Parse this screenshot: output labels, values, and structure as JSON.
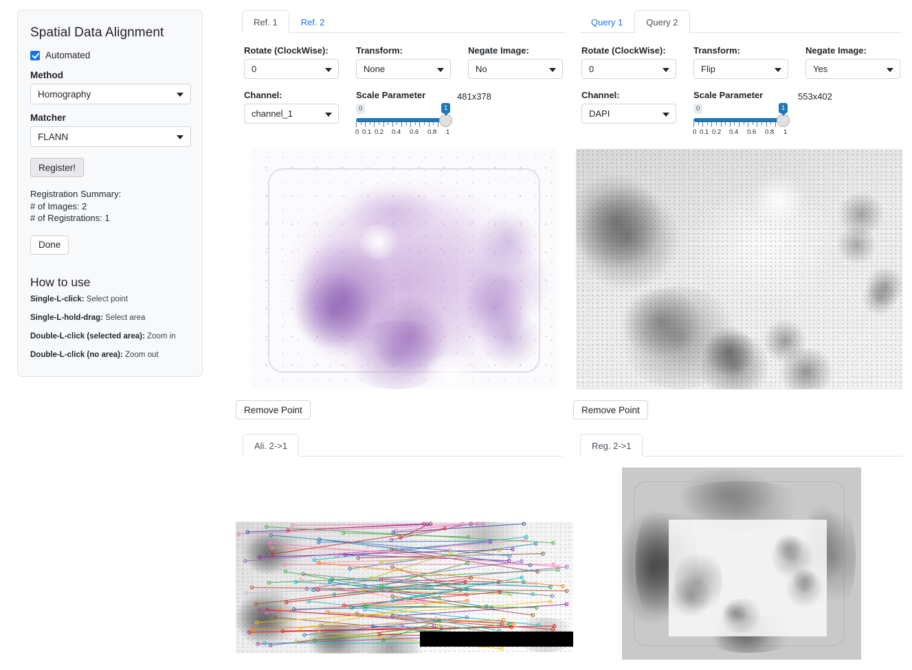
{
  "sidebar": {
    "title": "Spatial Data Alignment",
    "automated_label": "Automated",
    "automated_checked": true,
    "method_label": "Method",
    "method_value": "Homography",
    "matcher_label": "Matcher",
    "matcher_value": "FLANN",
    "register_button": "Register!",
    "summary": {
      "heading": "Registration Summary:",
      "images_line": "# of Images: 2",
      "registrations_line": "# of Registrations: 1"
    },
    "done_button": "Done",
    "howto": {
      "title": "How to use",
      "items": [
        {
          "key": "Single-L-click:",
          "value": " Select point"
        },
        {
          "key": "Single-L-hold-drag:",
          "value": " Select area"
        },
        {
          "key": "Double-L-click (selected area):",
          "value": " Zoom in"
        },
        {
          "key": "Double-L-click (no area):",
          "value": " Zoom out"
        }
      ]
    }
  },
  "reference_panel": {
    "tabs": [
      {
        "label": "Ref. 1",
        "active": true
      },
      {
        "label": "Ref. 2",
        "active": false
      }
    ],
    "controls": {
      "rotate_label": "Rotate (ClockWise):",
      "rotate_value": "0",
      "transform_label": "Transform:",
      "transform_value": "None",
      "negate_label": "Negate Image:",
      "negate_value": "No",
      "channel_label": "Channel:",
      "channel_value": "channel_1",
      "scale_label": "Scale Parameter",
      "scale_min_badge": "0",
      "scale_value_badge": "1",
      "scale_value": 1,
      "scale_tick_labels": [
        "0",
        "0.1",
        "0.2",
        "0.4",
        "0.6",
        "0.8",
        "1"
      ],
      "dimensions": "481x378"
    },
    "remove_point_button": "Remove Point",
    "result_tab": "Ali. 2->1"
  },
  "query_panel": {
    "tabs": [
      {
        "label": "Query 1",
        "active": false
      },
      {
        "label": "Query 2",
        "active": true
      }
    ],
    "controls": {
      "rotate_label": "Rotate (ClockWise):",
      "rotate_value": "0",
      "transform_label": "Transform:",
      "transform_value": "Flip",
      "negate_label": "Negate Image:",
      "negate_value": "Yes",
      "channel_label": "Channel:",
      "channel_value": "DAPI",
      "scale_label": "Scale Parameter",
      "scale_min_badge": "0",
      "scale_value_badge": "1",
      "scale_value": 1,
      "scale_tick_labels": [
        "0",
        "0.1",
        "0.2",
        "0.4",
        "0.6",
        "0.8",
        "1"
      ],
      "dimensions": "553x402"
    },
    "remove_point_button": "Remove Point",
    "result_tab": "Reg. 2->1"
  },
  "colors": {
    "accent": "#1a73e8",
    "slider": "#1f77b4",
    "panel_bg": "#f8f9fa",
    "border": "#dee2e6"
  }
}
